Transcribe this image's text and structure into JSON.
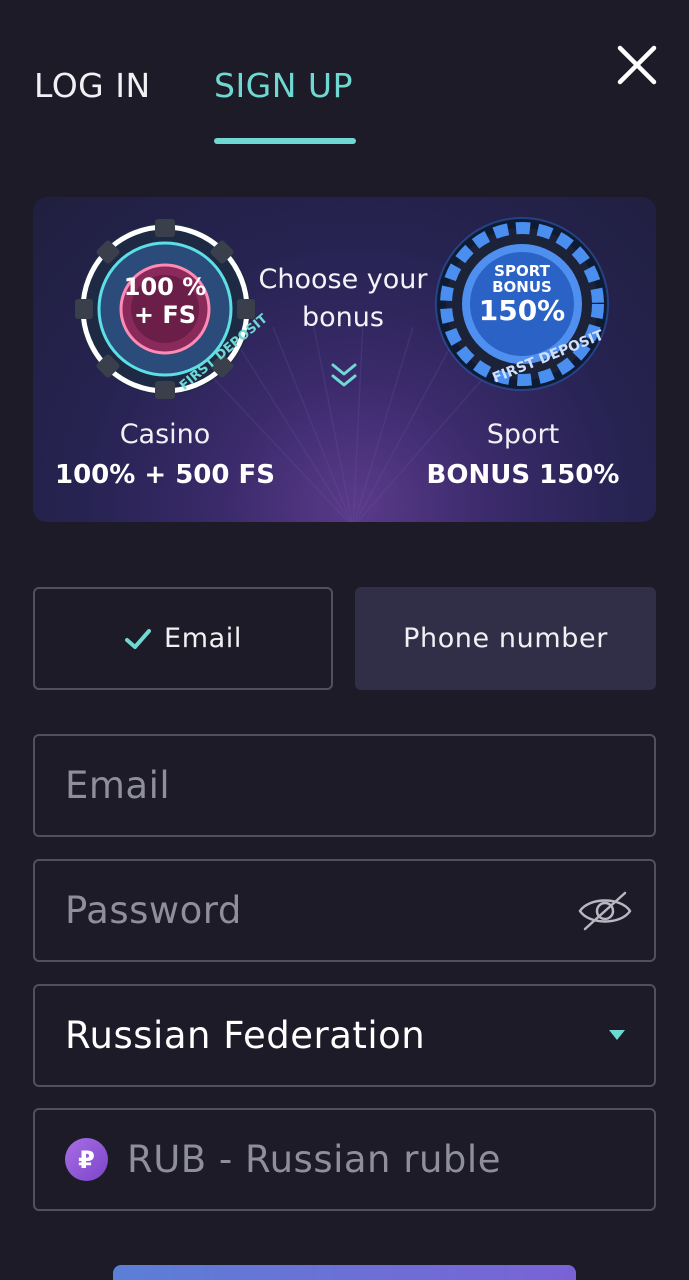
{
  "tabs": {
    "login_label": "LOG IN",
    "signup_label": "SIGN UP",
    "active": "signup"
  },
  "close": {
    "icon": "close-icon"
  },
  "banner": {
    "heading": "Choose your bonus",
    "casino": {
      "chip_line1": "100 %",
      "chip_line2": "+ FS",
      "chip_ring_text": "FIRST DEPOSIT",
      "label": "Casino",
      "value": "100% + 500 FS"
    },
    "sport": {
      "chip_line1": "SPORT",
      "chip_line2": "BONUS",
      "chip_line3": "150%",
      "chip_ring_text": "FIRST DEPOSIT",
      "label": "Sport",
      "value": "BONUS 150%"
    }
  },
  "method": {
    "email_label": "Email",
    "phone_label": "Phone number",
    "selected": "email"
  },
  "form": {
    "email_placeholder": "Email",
    "password_placeholder": "Password",
    "country_value": "Russian Federation",
    "currency_symbol": "₽",
    "currency_value": "RUB - Russian ruble"
  },
  "colors": {
    "accent": "#6fd8d2",
    "background": "#1c1b27",
    "inactive_button": "#302f47",
    "border": "#51505f"
  }
}
